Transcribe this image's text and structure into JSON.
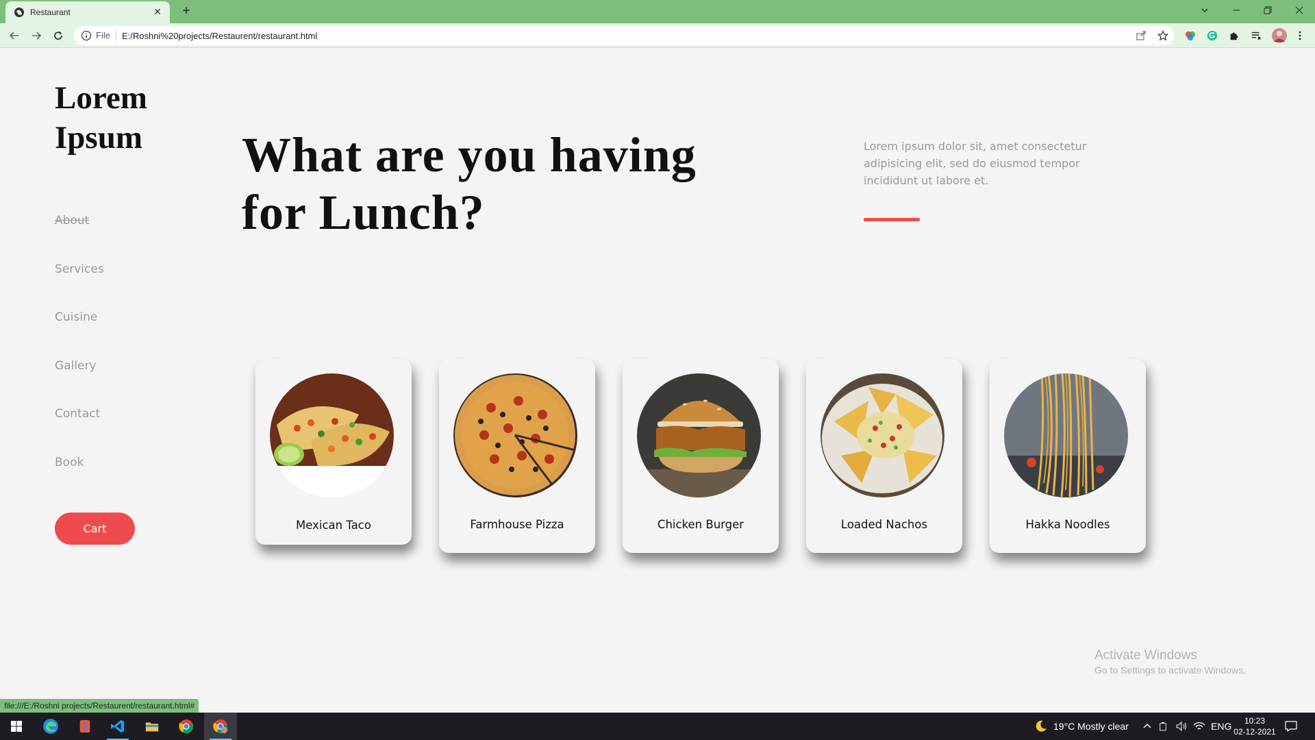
{
  "browser": {
    "tab_title": "Restaurant",
    "new_tab": "+",
    "url_scheme": "File",
    "url": "E:/Roshni%20projects/Restaurent/restaurant.html",
    "status_url": "file:///E:/Roshni projects/Restaurent/restaurant.html#"
  },
  "sidebar": {
    "logo": "Lorem Ipsum",
    "nav": [
      {
        "label": "About",
        "active": true
      },
      {
        "label": "Services"
      },
      {
        "label": "Cuisine"
      },
      {
        "label": "Gallery"
      },
      {
        "label": "Contact"
      },
      {
        "label": "Book"
      }
    ],
    "cart_label": "Cart"
  },
  "hero": {
    "title": "What are you having for Lunch?",
    "description": "Lorem ipsum dolor sit, amet consectetur adipisicing elit, sed do eiusmod tempor incididunt ut labore et."
  },
  "cards": [
    {
      "name": "Mexican Taco",
      "image": "taco-image"
    },
    {
      "name": "Farmhouse Pizza",
      "image": "pizza-image"
    },
    {
      "name": "Chicken Burger",
      "image": "burger-image"
    },
    {
      "name": "Loaded Nachos",
      "image": "nachos-image"
    },
    {
      "name": "Hakka Noodles",
      "image": "noodles-image"
    }
  ],
  "watermark": {
    "line1": "Activate Windows",
    "line2": "Go to Settings to activate Windows."
  },
  "taskbar": {
    "weather": "19°C  Mostly clear",
    "language": "ENG",
    "time": "10:23",
    "date": "02-12-2021"
  },
  "colors": {
    "accent": "#ef4b4e",
    "browser_frame": "#7cbf7c",
    "page_bg": "#f4f4f4"
  }
}
